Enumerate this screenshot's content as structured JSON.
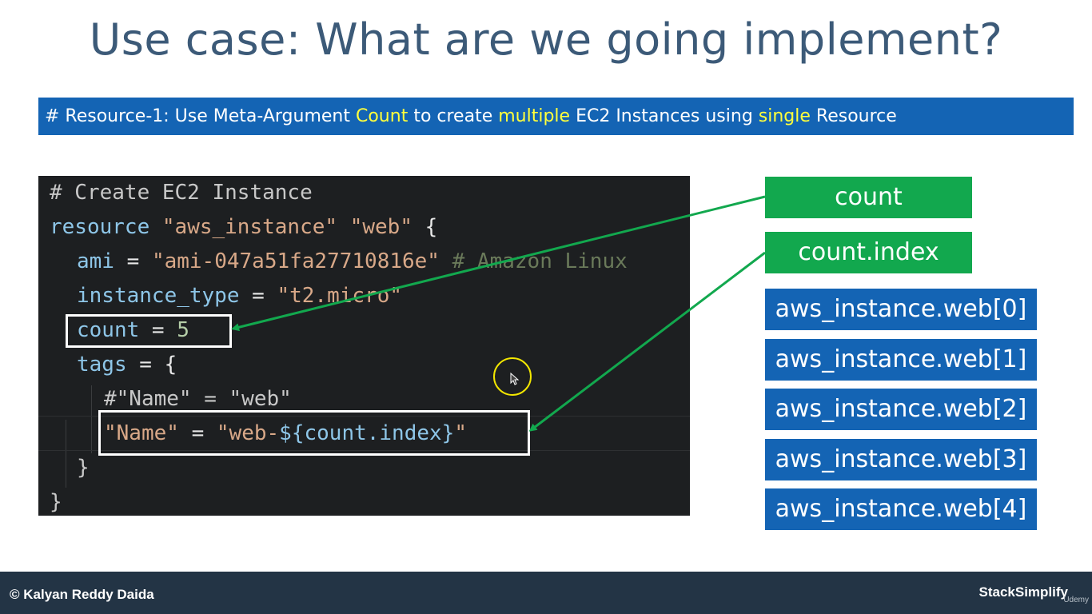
{
  "slide": {
    "title": "Use case: What are we going implement?"
  },
  "banner": {
    "prefix": "# Resource-1: Use Meta-Argument ",
    "hl1": "Count",
    "mid1": " to create ",
    "hl2": "multiple",
    "mid2": " EC2 Instances using ",
    "hl3": "single",
    "suffix": " Resource"
  },
  "code": {
    "l1": "# Create EC2 Instance",
    "l2_kw": "resource",
    "l2_s1": "\"aws_instance\"",
    "l2_s2": "\"web\"",
    "l2_brace": "{",
    "l3_key": "ami",
    "l3_eq": " = ",
    "l3_val": "\"ami-047a51fa27710816e\"",
    "l3_comment": " # Amazon Linux",
    "l4_key": "instance_type",
    "l4_eq": " = ",
    "l4_val": "\"t2.micro\"",
    "l5_key": "count",
    "l5_eq": " = ",
    "l5_val": "5",
    "l6_key": "tags",
    "l6_eq": " = ",
    "l6_brace": "{",
    "l7": "#\"Name\" = \"web\"",
    "l8_key": "\"Name\"",
    "l8_eq": " = ",
    "l8_v1": "\"web-",
    "l8_v2": "${count.index}",
    "l8_v3": "\"",
    "l9": "}",
    "l10": "}"
  },
  "labels": {
    "count": "count",
    "count_index": "count.index",
    "instances": [
      "aws_instance.web[0]",
      "aws_instance.web[1]",
      "aws_instance.web[2]",
      "aws_instance.web[3]",
      "aws_instance.web[4]"
    ]
  },
  "footer": {
    "copyright": "© Kalyan Reddy Daida",
    "brand": "StackSimplify",
    "udemy": "Udemy"
  },
  "colors": {
    "banner_bg": "#1464b4",
    "banner_highlight": "#ffff3c",
    "green_box": "#12a84e",
    "blue_box": "#1464b4",
    "code_bg": "#1d1f21",
    "footer_bg": "#233445",
    "arrow": "#12a84e"
  }
}
